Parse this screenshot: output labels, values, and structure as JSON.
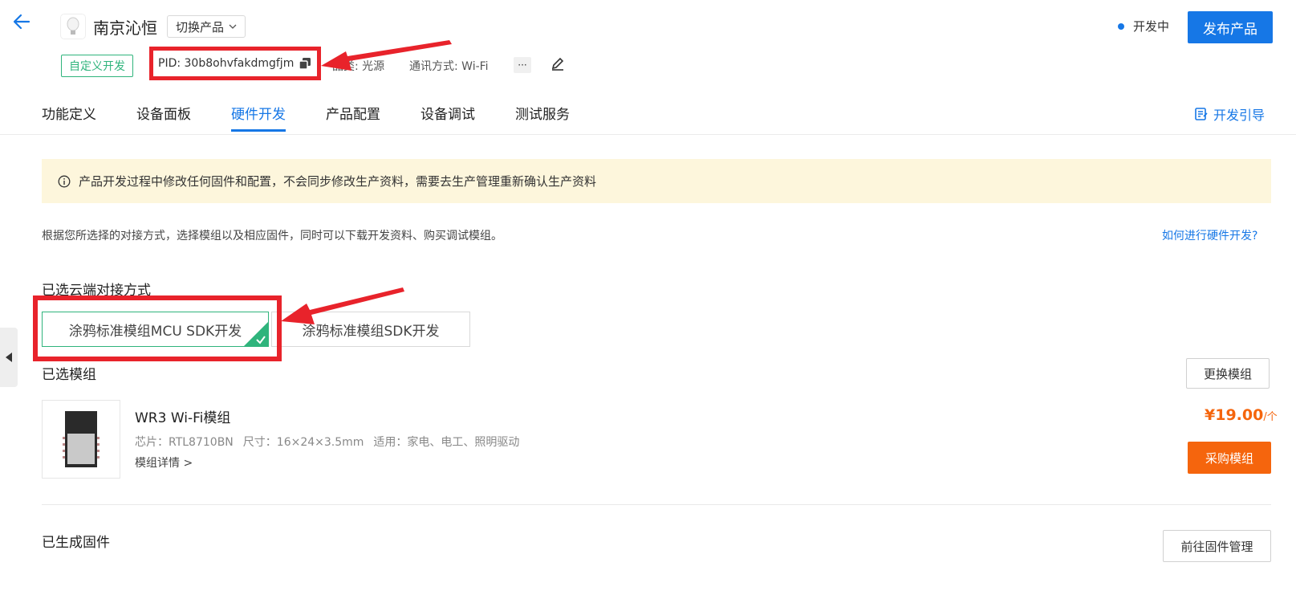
{
  "header": {
    "product_name": "南京沁恒",
    "switch_label": "切换产品",
    "status": "开发中",
    "publish_label": "发布产品",
    "custom_tag": "自定义开发",
    "pid_text": "PID: 30b8ohvfakdmgfjm",
    "category_text": "品类: 光源",
    "comm_text": "通讯方式: Wi-Fi",
    "more_label": "···",
    "accent_color": "#1677e6"
  },
  "tabs": [
    {
      "label": "功能定义"
    },
    {
      "label": "设备面板"
    },
    {
      "label": "硬件开发"
    },
    {
      "label": "产品配置"
    },
    {
      "label": "设备调试"
    },
    {
      "label": "测试服务"
    }
  ],
  "guide_label": "开发引导",
  "notice": "产品开发过程中修改任何固件和配置，不会同步修改生产资料，需要去生产管理重新确认生产资料",
  "description": "根据您所选择的对接方式，选择模组以及相应固件，同时可以下载开发资料、购买调试模组。",
  "howto_link": "如何进行硬件开发?",
  "cloud_section": {
    "title": "已选云端对接方式",
    "options": [
      {
        "label": "涂鸦标准模组MCU SDK开发",
        "selected": true
      },
      {
        "label": "涂鸦标准模组SDK开发",
        "selected": false
      }
    ]
  },
  "module_section": {
    "title": "已选模组",
    "change_label": "更换模组",
    "module_name": "WR3 Wi-Fi模组",
    "chip": "芯片：RTL8710BN",
    "size": "尺寸：16×24×3.5mm",
    "usage": "适用：家电、电工、照明驱动",
    "detail_link": "模组详情 >",
    "price": "¥19.00",
    "price_unit": "/个",
    "buy_label": "采购模组"
  },
  "firmware_section": {
    "title": "已生成固件",
    "manage_label": "前往固件管理"
  },
  "colors": {
    "annotation_red": "#e8232b",
    "green": "#2fb47c",
    "orange": "#f5650d"
  }
}
